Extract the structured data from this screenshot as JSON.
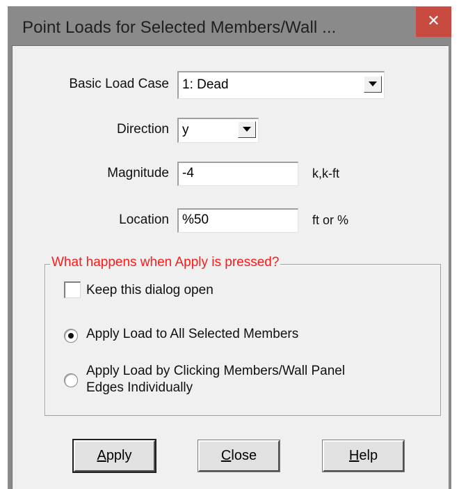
{
  "window": {
    "title": "Point Loads for Selected Members/Wall ...",
    "close_glyph": "✕"
  },
  "form": {
    "basic_load_case": {
      "label": "Basic Load Case",
      "value": "1: Dead"
    },
    "direction": {
      "label": "Direction",
      "value": "y"
    },
    "magnitude": {
      "label": "Magnitude",
      "value": "-4",
      "unit": "k,k-ft"
    },
    "location": {
      "label": "Location",
      "value": "%50",
      "unit": "ft or %"
    }
  },
  "group": {
    "caption": "What happens when Apply is pressed?",
    "keep_open": {
      "label": "Keep this dialog open",
      "checked": false
    },
    "options": [
      {
        "label": "Apply Load to All Selected Members",
        "selected": true
      },
      {
        "label_line1": "Apply Load by Clicking Members/Wall Panel",
        "label_line2": "Edges Individually",
        "selected": false
      }
    ]
  },
  "buttons": {
    "apply": {
      "mnemonic": "A",
      "rest": "pply"
    },
    "close": {
      "mnemonic": "C",
      "rest": "lose"
    },
    "help": {
      "mnemonic": "H",
      "rest": "elp"
    }
  },
  "colors": {
    "group_caption": "#ff1a1a",
    "close_button": "#c74b40",
    "titlebar": "#8a8a8a",
    "dialog_face": "#f0f0f0"
  },
  "icons": {
    "dropdown": "chevron-down-icon",
    "close": "close-icon"
  }
}
